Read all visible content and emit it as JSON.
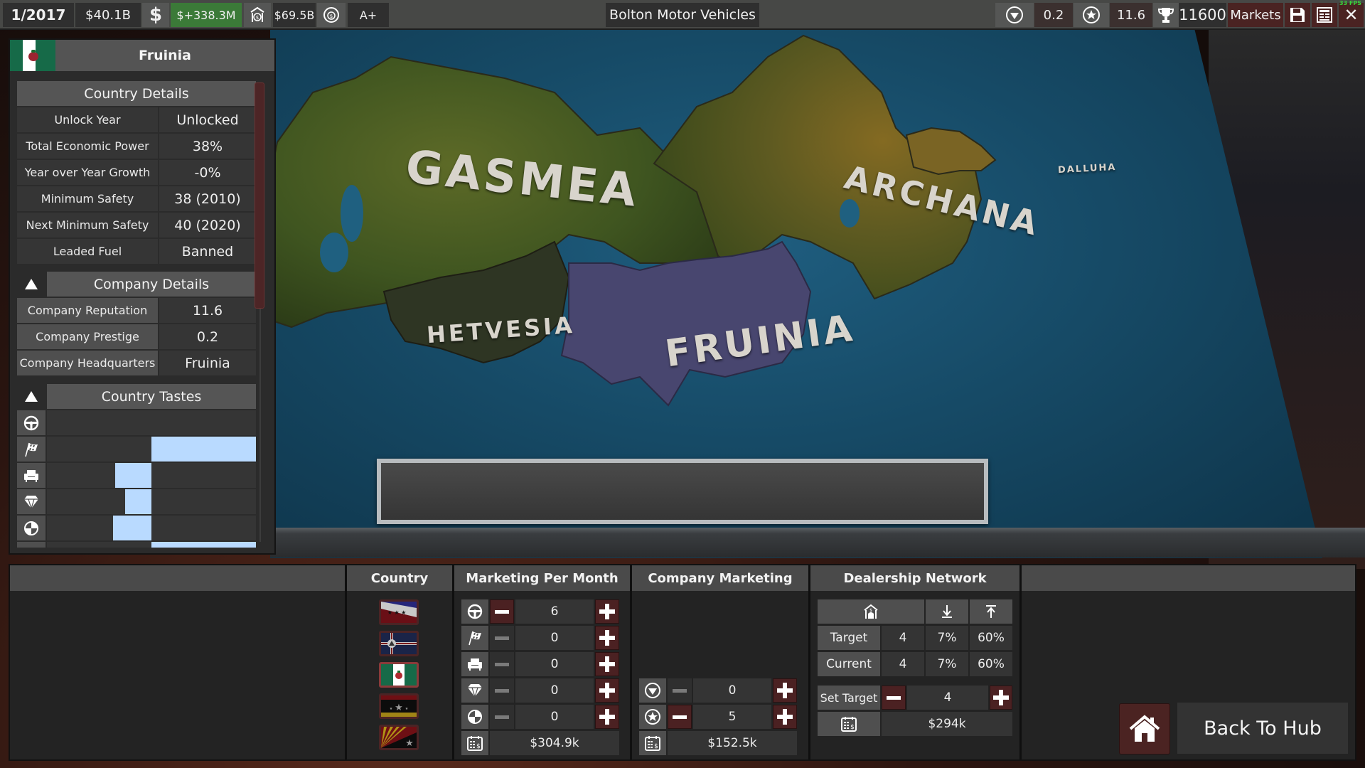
{
  "topbar": {
    "date": "1/2017",
    "cash": "$40.1B",
    "monthly_profit": "$+338.3M",
    "company_value": "$69.5B",
    "credit_rating": "A+",
    "company_name": "Bolton Motor Vehicles",
    "prestige": "0.2",
    "reputation": "11.6",
    "score": "11600",
    "markets_label": "Markets",
    "fps": "33 FPS",
    "icons": [
      "dollar-icon",
      "bank-value-icon",
      "coin-rating-icon",
      "diamond-icon",
      "star-icon",
      "trophy-icon",
      "save-icon",
      "layout-icon",
      "close-icon"
    ]
  },
  "country_panel": {
    "country_name": "Fruinia",
    "country_details": {
      "title": "Country Details",
      "rows": [
        {
          "label": "Unlock Year",
          "value": "Unlocked"
        },
        {
          "label": "Total Economic Power",
          "value": "38%"
        },
        {
          "label": "Year over Year Growth",
          "value": "-0%"
        },
        {
          "label": "Minimum Safety",
          "value": "38 (2010)"
        },
        {
          "label": "Next Minimum Safety",
          "value": "40 (2020)"
        },
        {
          "label": "Leaded Fuel",
          "value": "Banned"
        }
      ]
    },
    "company_details": {
      "title": "Company Details",
      "rows": [
        {
          "label": "Company Reputation",
          "value": "11.6"
        },
        {
          "label": "Company Prestige",
          "value": "0.2"
        },
        {
          "label": "Company Headquarters",
          "value": "Fruinia"
        }
      ]
    },
    "country_tastes": {
      "title": "Country Tastes",
      "note": "bars are signed relative to a center line; values are fractions of the half-width",
      "items": [
        {
          "icon": "steering-wheel-icon",
          "value": 0.0
        },
        {
          "icon": "racing-flag-icon",
          "value": 1.0
        },
        {
          "icon": "armchair-comfort-icon",
          "value": -0.35
        },
        {
          "icon": "diamond-luxury-icon",
          "value": -0.25
        },
        {
          "icon": "crash-test-safety-icon",
          "value": -0.37
        },
        {
          "icon": "partial-hidden-icon",
          "value": 1.0
        }
      ]
    }
  },
  "map": {
    "regions": [
      {
        "name": "GASMEA",
        "selected": false
      },
      {
        "name": "ARCHANA",
        "selected": false
      },
      {
        "name": "DALLUHA",
        "selected": false
      },
      {
        "name": "HETVESIA",
        "selected": false
      },
      {
        "name": "FRUINIA",
        "selected": true
      }
    ],
    "plaque_text": "",
    "colors": {
      "ocean": "#1b5573",
      "selected_region": "#4a4a78",
      "land_green": "#4b5a22",
      "land_gold": "#7a6424"
    }
  },
  "bottom_panel": {
    "country": {
      "header": "Country",
      "flags": [
        {
          "name": "flag-blue-white-red-stars",
          "selected": false
        },
        {
          "name": "flag-navy-cross-emblem",
          "selected": false
        },
        {
          "name": "flag-fruinia-tomato",
          "selected": true
        },
        {
          "name": "flag-black-red-gold-star",
          "selected": false
        },
        {
          "name": "flag-sunburst-star",
          "selected": false
        }
      ]
    },
    "marketing_per_month": {
      "header": "Marketing Per Month",
      "rows": [
        {
          "icon": "steering-wheel-icon",
          "value": "6",
          "minus_enabled": true
        },
        {
          "icon": "racing-flag-icon",
          "value": "0",
          "minus_enabled": false
        },
        {
          "icon": "armchair-comfort-icon",
          "value": "0",
          "minus_enabled": false
        },
        {
          "icon": "diamond-luxury-icon",
          "value": "0",
          "minus_enabled": false
        },
        {
          "icon": "crash-test-safety-icon",
          "value": "0",
          "minus_enabled": false
        }
      ],
      "monthly_cost": "$304.9k"
    },
    "company_marketing": {
      "header": "Company Marketing",
      "rows": [
        {
          "icon": "diamond-prestige-icon",
          "value": "0",
          "minus_enabled": false
        },
        {
          "icon": "star-reputation-icon",
          "value": "5",
          "minus_enabled": true
        }
      ],
      "monthly_cost": "$152.5k"
    },
    "dealership_network": {
      "header": "Dealership Network",
      "columns": [
        "dealership-icon",
        "download-icon",
        "upload-icon"
      ],
      "rows": [
        {
          "label": "Target",
          "count": "4",
          "pct_a": "7%",
          "pct_b": "60%"
        },
        {
          "label": "Current",
          "count": "4",
          "pct_a": "7%",
          "pct_b": "60%"
        }
      ],
      "set_target_label": "Set Target",
      "set_target_value": "4",
      "monthly_cost": "$294k"
    },
    "back_to_hub": "Back To Hub"
  }
}
